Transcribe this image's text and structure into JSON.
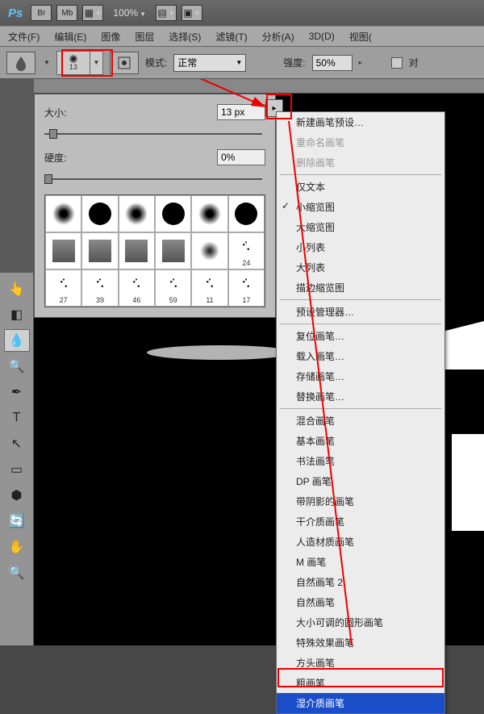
{
  "titlebar": {
    "logo": "Ps",
    "br": "Br",
    "mb": "Mb",
    "zoom": "100%"
  },
  "menubar": {
    "file": "文件(F)",
    "edit": "编辑(E)",
    "image": "图像",
    "layer": "图层",
    "select": "选择(S)",
    "filter": "滤镜(T)",
    "analysis": "分析(A)",
    "threeD": "3D(D)",
    "view": "视图("
  },
  "options": {
    "brush_size": "13",
    "mode_label": "模式:",
    "mode_value": "正常",
    "strength_label": "强度:",
    "strength_value": "50%",
    "checkbox_label": "对"
  },
  "brush_panel": {
    "size_label": "大小:",
    "size_value": "13 px",
    "hardness_label": "硬度:",
    "hardness_value": "0%",
    "brushes": [
      {
        "label": "",
        "type": "soft-round"
      },
      {
        "label": "",
        "type": "hard-round"
      },
      {
        "label": "",
        "type": "soft-round"
      },
      {
        "label": "",
        "type": "hard-round"
      },
      {
        "label": "",
        "type": "soft-round"
      },
      {
        "label": "",
        "type": "hard-round"
      },
      {
        "label": "",
        "type": "chalk"
      },
      {
        "label": "",
        "type": "chalk"
      },
      {
        "label": "",
        "type": "chalk"
      },
      {
        "label": "",
        "type": "chalk"
      },
      {
        "label": "",
        "type": "spray"
      },
      {
        "label": "24",
        "type": "scatter"
      },
      {
        "label": "27",
        "type": "scatter"
      },
      {
        "label": "39",
        "type": "scatter"
      },
      {
        "label": "46",
        "type": "scatter"
      },
      {
        "label": "59",
        "type": "scatter"
      },
      {
        "label": "11",
        "type": "scatter"
      },
      {
        "label": "17",
        "type": "scatter"
      }
    ]
  },
  "context_menu": {
    "items": [
      {
        "label": "新建画笔预设…",
        "type": "item"
      },
      {
        "label": "重命名画笔",
        "type": "disabled"
      },
      {
        "label": "删除画笔",
        "type": "disabled"
      },
      {
        "type": "sep"
      },
      {
        "label": "仅文本",
        "type": "item"
      },
      {
        "label": "小缩览图",
        "type": "item",
        "checked": true
      },
      {
        "label": "大缩览图",
        "type": "item"
      },
      {
        "label": "小列表",
        "type": "item"
      },
      {
        "label": "大列表",
        "type": "item"
      },
      {
        "label": "描边缩览图",
        "type": "item"
      },
      {
        "type": "sep"
      },
      {
        "label": "预设管理器…",
        "type": "item"
      },
      {
        "type": "sep"
      },
      {
        "label": "复位画笔…",
        "type": "item"
      },
      {
        "label": "载入画笔…",
        "type": "item"
      },
      {
        "label": "存储画笔…",
        "type": "item"
      },
      {
        "label": "替换画笔…",
        "type": "item"
      },
      {
        "type": "sep"
      },
      {
        "label": "混合画笔",
        "type": "item"
      },
      {
        "label": "基本画笔",
        "type": "item"
      },
      {
        "label": "书法画笔",
        "type": "item"
      },
      {
        "label": "DP 画笔",
        "type": "item"
      },
      {
        "label": "带阴影的画笔",
        "type": "item"
      },
      {
        "label": "干介质画笔",
        "type": "item"
      },
      {
        "label": "人造材质画笔",
        "type": "item"
      },
      {
        "label": "M 画笔",
        "type": "item"
      },
      {
        "label": "自然画笔 2",
        "type": "item"
      },
      {
        "label": "自然画笔",
        "type": "item"
      },
      {
        "label": "大小可调的圆形画笔",
        "type": "item"
      },
      {
        "label": "特殊效果画笔",
        "type": "item"
      },
      {
        "label": "方头画笔",
        "type": "item"
      },
      {
        "label": "粗画笔",
        "type": "item"
      },
      {
        "label": "湿介质画笔",
        "type": "highlight"
      }
    ]
  }
}
